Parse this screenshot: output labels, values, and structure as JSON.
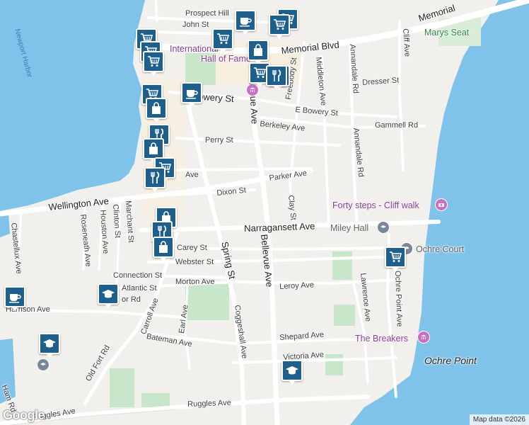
{
  "map": {
    "colors": {
      "land": "#f1f0ec",
      "water": "#7fc3ea",
      "park": "#c8e6c9",
      "road": "#ffffff",
      "major_road": "#e8eaed",
      "pin": "#1f5f8b"
    },
    "water_labels": {
      "harbor": "Newport Harbor"
    },
    "streets": {
      "memorial_blvd": "Memorial Blvd",
      "memorial_east": "Memorial",
      "prospect_hill": "Prospect Hill",
      "john_st": "John St",
      "bowery_st": "Bowery St",
      "e_bowery_st": "E Bowery St",
      "berkeley_ave": "Berkeley Ave",
      "perry_st": "Perry St",
      "parker_ave": "Parker Ave",
      "dixon_st": "Dixon St",
      "wellington_ave": "Wellington Ave",
      "narragansett_ave": "Narragansett Ave",
      "carey_st": "Carey St",
      "webster_st": "Webster St",
      "connection_st": "Connection St",
      "atlantic_st": "Atlantic St",
      "morton_ave": "Morton Ave",
      "leroy_ave": "Leroy Ave",
      "harrison_ave": "Harrison Ave",
      "bateman_ave": "Bateman Ave",
      "shepard_ave": "Shepard Ave",
      "victoria_ave": "Victoria Ave",
      "ruggles_ave_left": "Ruggles Ave",
      "ruggles_ave": "Ruggles Ave",
      "bellevue_ave": "Bellevue Ave",
      "bellevue_ave_top": "Bellevue Ave",
      "spring_st": "Spring St",
      "coggeshall_ave": "Coggeshall Ave",
      "carroll_ave": "Carroll Ave",
      "earl_ave": "Earl Ave",
      "old_fort_rd": "Old Fort Rd",
      "freebody_st": "Freebody St",
      "middleton_ave": "Middleton Ave",
      "annandale_rd_top": "Annandale Rd",
      "annandale_rd": "Annandale Rd",
      "cliff_ave": "Cliff Ave",
      "dresser_st": "Dresser St",
      "gammell_rd": "Gammell Rd",
      "clay_st": "Clay St",
      "lawrence_ave": "Lawrence Ave",
      "ochre_point_ave": "Ochre Point Ave",
      "chastellux_ave": "Chastellux Ave",
      "roseneath_ave": "Roseneath Ave",
      "houston_ave": "Houston Ave",
      "clinton_st": "Clinton St",
      "marchant_st": "Marchant St",
      "bedford_ave": "Ave",
      "ham_rd": "Ham Rd",
      "end_st": "St",
      "hunter_rd": "or Rd"
    },
    "pois": {
      "marys_seat": "Marys Seat",
      "forty_steps": "Forty steps - Cliff walk",
      "miley_hall": "Miley Hall",
      "ochre_court": "Ochre Court",
      "the_breakers": "The Breakers",
      "ochre_point": "Ochre Point",
      "hall_of_fame_1": "International",
      "hall_of_fame_2": "Hall of Fame"
    },
    "attribution": "Map data ©2026",
    "logo": "Google",
    "pins": [
      {
        "type": "coffee-icon"
      },
      {
        "type": "cart-icon"
      },
      {
        "type": "cart-icon"
      },
      {
        "type": "cart-icon"
      },
      {
        "type": "cart-icon"
      },
      {
        "type": "cart-icon"
      },
      {
        "type": "cart-icon"
      },
      {
        "type": "bag-icon"
      },
      {
        "type": "cart-icon"
      },
      {
        "type": "fork-knife-icon"
      },
      {
        "type": "fork-knife-icon"
      },
      {
        "type": "coffee-icon"
      },
      {
        "type": "cart-icon"
      },
      {
        "type": "bag-icon"
      },
      {
        "type": "fork-knife-icon"
      },
      {
        "type": "bag-icon"
      },
      {
        "type": "cart-icon"
      },
      {
        "type": "fork-knife-icon"
      },
      {
        "type": "bag-icon"
      },
      {
        "type": "fork-knife-icon"
      },
      {
        "type": "bag-icon"
      },
      {
        "type": "coffee-icon"
      },
      {
        "type": "graduation-cap-icon"
      },
      {
        "type": "graduation-cap-icon"
      },
      {
        "type": "graduation-cap-icon"
      },
      {
        "type": "cart-icon"
      }
    ]
  }
}
